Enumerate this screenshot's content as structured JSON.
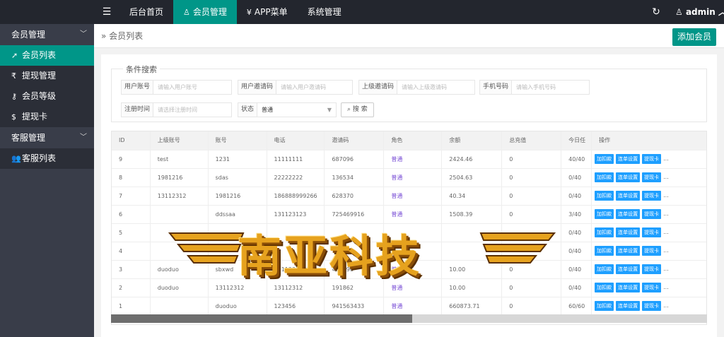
{
  "topbar": {
    "menu_icon": "hamburger-icon",
    "nav": [
      {
        "label": "后台首页",
        "icon": ""
      },
      {
        "label": "会员管理",
        "icon": "user-icon"
      },
      {
        "label": "APP菜单",
        "icon": "yen-icon"
      },
      {
        "label": "系统管理",
        "icon": ""
      }
    ],
    "active_index": 1,
    "user": "admin",
    "refresh_icon": "refresh-icon"
  },
  "sidebar": {
    "groups": [
      {
        "label": "会员管理",
        "items": [
          {
            "label": "会员列表",
            "icon": "rocket-icon"
          },
          {
            "label": "提现管理",
            "icon": "rupee-icon"
          },
          {
            "label": "会员等级",
            "icon": "key-icon"
          },
          {
            "label": "提现卡",
            "icon": "dollar-icon"
          }
        ]
      },
      {
        "label": "客服管理",
        "items": [
          {
            "label": "客服列表",
            "icon": "users-icon"
          }
        ]
      }
    ]
  },
  "breadcrumb": "会员列表",
  "add_button": "添加会员",
  "search": {
    "legend": "条件搜索",
    "fields": [
      {
        "label": "用户账号",
        "placeholder": "请输入用户账号"
      },
      {
        "label": "用户邀请码",
        "placeholder": "请输入用户邀请码"
      },
      {
        "label": "上级邀请码",
        "placeholder": "请输入上级邀请码"
      },
      {
        "label": "手机号码",
        "placeholder": "请输入手机号码"
      },
      {
        "label": "注册时间",
        "placeholder": "请选择注册时间"
      }
    ],
    "status_label": "状态",
    "status_value": "普通",
    "search_button": "搜 索"
  },
  "table": {
    "headers": [
      "ID",
      "上级账号",
      "账号",
      "电话",
      "邀请码",
      "角色",
      "余额",
      "总充值",
      "今日任",
      "操作"
    ],
    "ops": [
      "加扣款",
      "连单设置",
      "提现卡",
      "..."
    ],
    "rows": [
      [
        "9",
        "test",
        "1231",
        "11111111",
        "687096",
        "普通",
        "2424.46",
        "0",
        "40/40"
      ],
      [
        "8",
        "1981216",
        "sdas",
        "22222222",
        "136534",
        "普通",
        "2504.63",
        "0",
        "0/40"
      ],
      [
        "7",
        "13112312",
        "1981216",
        "186888999266",
        "628370",
        "普通",
        "40.34",
        "0",
        "0/40"
      ],
      [
        "6",
        "",
        "ddssaa",
        "131123123",
        "725469916",
        "普通",
        "1508.39",
        "0",
        "3/40"
      ],
      [
        "5",
        "",
        "",
        "",
        "",
        "",
        "",
        "",
        "0/40"
      ],
      [
        "4",
        "",
        "",
        "",
        "",
        "",
        "",
        "",
        "0/40"
      ],
      [
        "3",
        "duoduo",
        "sbxwd",
        "13112312312",
        "485196",
        "普通",
        "10.00",
        "0",
        "0/40"
      ],
      [
        "2",
        "duoduo",
        "13112312",
        "13112312",
        "191862",
        "普通",
        "10.00",
        "0",
        "0/40"
      ],
      [
        "1",
        "",
        "duoduo",
        "123456",
        "941563433",
        "普通",
        "660873.71",
        "0",
        "60/60"
      ]
    ]
  },
  "watermark": "南亚科技"
}
